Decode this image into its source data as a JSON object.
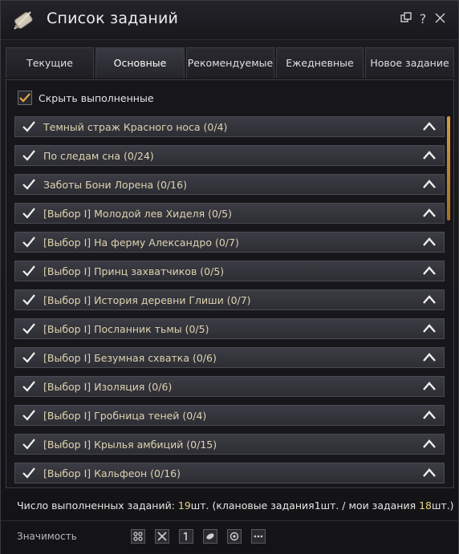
{
  "window": {
    "title": "Список заданий"
  },
  "tabs": [
    {
      "label": "Текущие",
      "active": false
    },
    {
      "label": "Основные",
      "active": true
    },
    {
      "label": "Рекомендуемые",
      "active": false
    },
    {
      "label": "Ежедневные",
      "active": false
    },
    {
      "label": "Новое задание",
      "active": false
    }
  ],
  "filter": {
    "hide_completed_label": "Скрыть выполненные",
    "hide_completed_checked": true
  },
  "quests": [
    {
      "name": "Темный страж Красного носа (0/4)"
    },
    {
      "name": "По следам сна (0/24)"
    },
    {
      "name": "Заботы Бони Лорена (0/16)"
    },
    {
      "name": "[Выбор I] Молодой лев Хиделя (0/5)"
    },
    {
      "name": "[Выбор I] На ферму Александро (0/7)"
    },
    {
      "name": "[Выбор I] Принц захватчиков (0/5)"
    },
    {
      "name": "[Выбор I] История деревни Глиши (0/7)"
    },
    {
      "name": "[Выбор I] Посланник тьмы (0/5)"
    },
    {
      "name": "[Выбор I] Безумная схватка (0/6)"
    },
    {
      "name": "[Выбор I] Изоляция (0/6)"
    },
    {
      "name": "[Выбор I] Гробница теней (0/4)"
    },
    {
      "name": "[Выбор I] Крылья амбиций (0/15)"
    },
    {
      "name": "[Выбор I] Кальфеон (0/16)"
    }
  ],
  "stats": {
    "prefix": "Число выполненных заданий: ",
    "total": "19",
    "mid1": "шт. (клановые задания",
    "clan": "1",
    "mid2": "шт. / мои задания ",
    "mine": "18",
    "suffix": "шт.)"
  },
  "footer": {
    "label": "Значимость",
    "icons": [
      "nodes-icon",
      "crossed-swords-icon",
      "flag-icon",
      "leaf-icon",
      "cog-icon",
      "more-icon"
    ]
  },
  "colors": {
    "accent": "#d89a3c",
    "quest_text": "#ddd3b0",
    "stat_number": "#e8d488"
  }
}
